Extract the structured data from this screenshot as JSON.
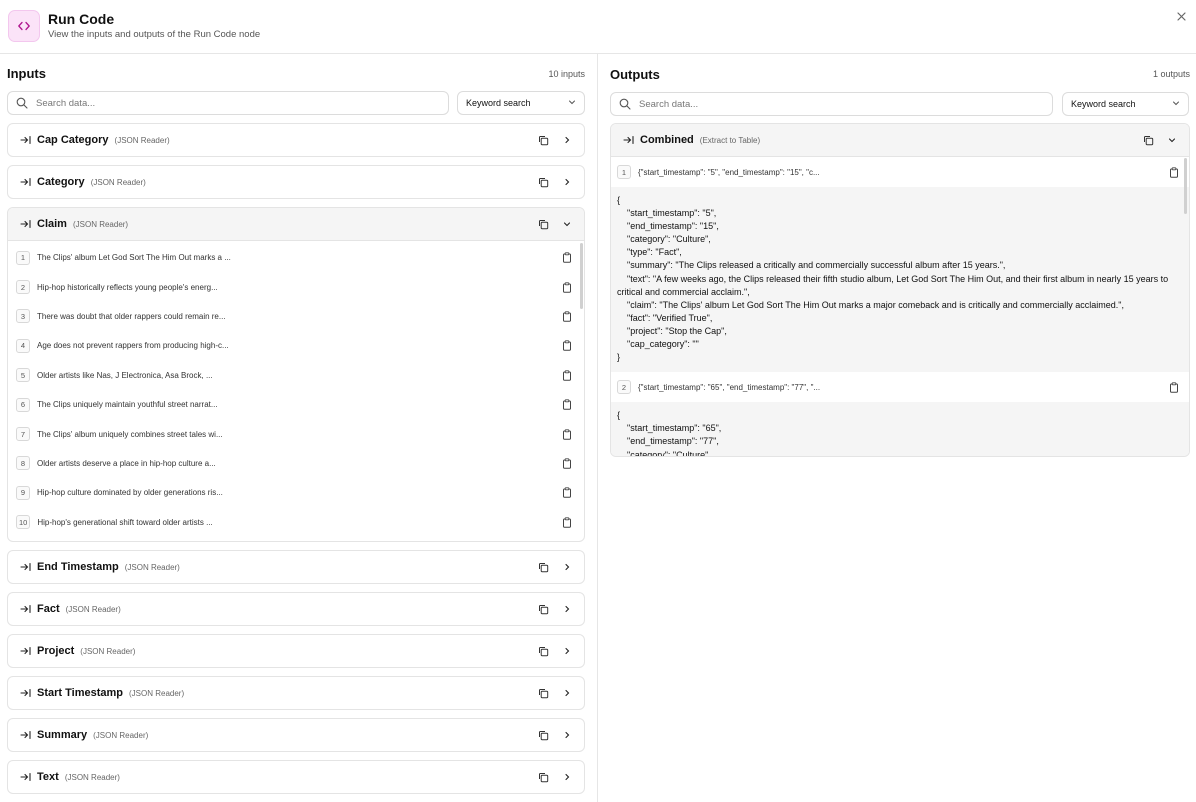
{
  "header": {
    "title": "Run Code",
    "subtitle": "View the inputs and outputs of the Run Code node",
    "accent": "#fbe3f8"
  },
  "inputs": {
    "title": "Inputs",
    "count": "10 inputs",
    "search_placeholder": "Search data...",
    "search_mode": "Keyword search",
    "cards": [
      {
        "name": "Cap Category",
        "type": "(JSON Reader)"
      },
      {
        "name": "Category",
        "type": "(JSON Reader)"
      },
      {
        "name": "Claim",
        "type": "(JSON Reader)",
        "expanded": true,
        "rows": [
          {
            "n": "1",
            "text": "The Clips' album Let God Sort The Him Out marks a ..."
          },
          {
            "n": "2",
            "text": "Hip-hop historically reflects young people's energ..."
          },
          {
            "n": "3",
            "text": "There was doubt that older rappers could remain re..."
          },
          {
            "n": "4",
            "text": "Age does not prevent rappers from producing high-c..."
          },
          {
            "n": "5",
            "text": "Older artists like Nas, J Electronica, Asa Brock, ..."
          },
          {
            "n": "6",
            "text": "The Clips uniquely maintain youthful street narrat..."
          },
          {
            "n": "7",
            "text": "The Clips' album uniquely combines street tales wi..."
          },
          {
            "n": "8",
            "text": "Older artists deserve a place in hip-hop culture a..."
          },
          {
            "n": "9",
            "text": "Hip-hop culture dominated by older generations ris..."
          },
          {
            "n": "10",
            "text": "Hip-hop's generational shift toward older artists ..."
          }
        ]
      },
      {
        "name": "End Timestamp",
        "type": "(JSON Reader)"
      },
      {
        "name": "Fact",
        "type": "(JSON Reader)"
      },
      {
        "name": "Project",
        "type": "(JSON Reader)"
      },
      {
        "name": "Start Timestamp",
        "type": "(JSON Reader)"
      },
      {
        "name": "Summary",
        "type": "(JSON Reader)"
      },
      {
        "name": "Text",
        "type": "(JSON Reader)"
      }
    ]
  },
  "outputs": {
    "title": "Outputs",
    "count": "1 outputs",
    "search_placeholder": "Search data...",
    "search_mode": "Keyword search",
    "card": {
      "name": "Combined",
      "type": "(Extract to Table)",
      "items": [
        {
          "n": "1",
          "preview": "{\"start_timestamp\": \"5\", \"end_timestamp\": \"15\", \"c...",
          "lines": [
            "{",
            "\"start_timestamp\": \"5\",",
            "\"end_timestamp\": \"15\",",
            "\"category\": \"Culture\",",
            "\"type\": \"Fact\",",
            "\"summary\": \"The Clips released a critically and commercially successful album after 15 years.\",",
            "\"text\": \"A few weeks ago, the Clips released their fifth studio album, Let God Sort The Him Out, and their first album in nearly 15 years to critical and commercial acclaim.\",",
            "\"claim\": \"The Clips' album Let God Sort The Him Out marks a major comeback and is critically and commercially acclaimed.\",",
            "\"fact\": \"Verified True\",",
            "\"project\": \"Stop the Cap\",",
            "\"cap_category\": \"\"",
            "}"
          ]
        },
        {
          "n": "2",
          "preview": "{\"start_timestamp\": \"65\", \"end_timestamp\": \"77\", \"...",
          "lines": [
            "{",
            "\"start_timestamp\": \"65\",",
            "\"end_timestamp\": \"77\",",
            "\"category\": \"Culture\","
          ]
        }
      ]
    }
  }
}
